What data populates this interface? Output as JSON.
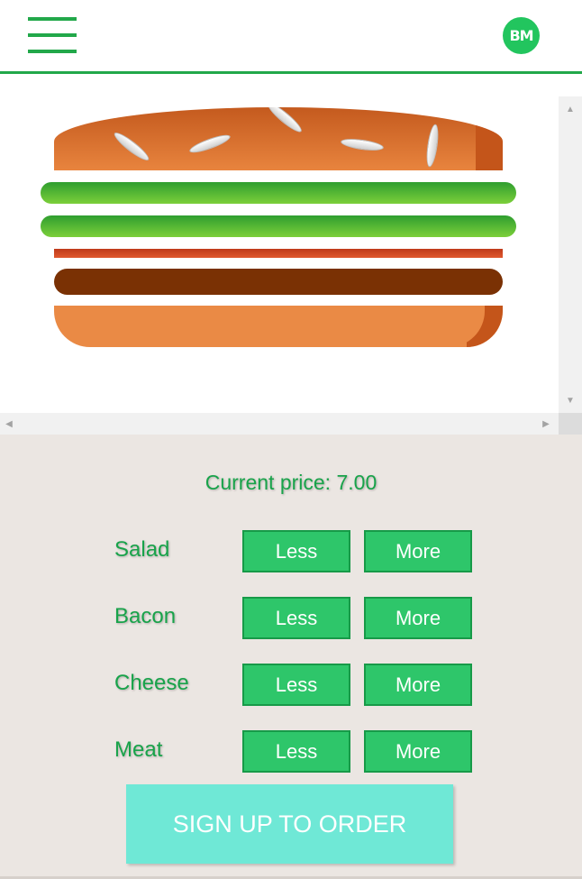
{
  "header": {
    "menu_icon": "hamburger-menu-icon",
    "logo_text": "BM",
    "accent_color": "#22a84a"
  },
  "burger": {
    "layers": [
      "bread-top",
      "salad",
      "salad",
      "bacon",
      "meat",
      "bread-bottom"
    ]
  },
  "controls": {
    "price_label": "Current price: 7.00",
    "ingredients": [
      {
        "label": "Salad",
        "less": "Less",
        "more": "More"
      },
      {
        "label": "Bacon",
        "less": "Less",
        "more": "More"
      },
      {
        "label": "Cheese",
        "less": "Less",
        "more": "More"
      },
      {
        "label": "Meat",
        "less": "Less",
        "more": "More"
      }
    ],
    "order_button": "SIGN UP TO ORDER"
  },
  "colors": {
    "button": "#2ec66a",
    "order_button": "#6fe8d6",
    "panel_bg": "#ebe6e2"
  }
}
